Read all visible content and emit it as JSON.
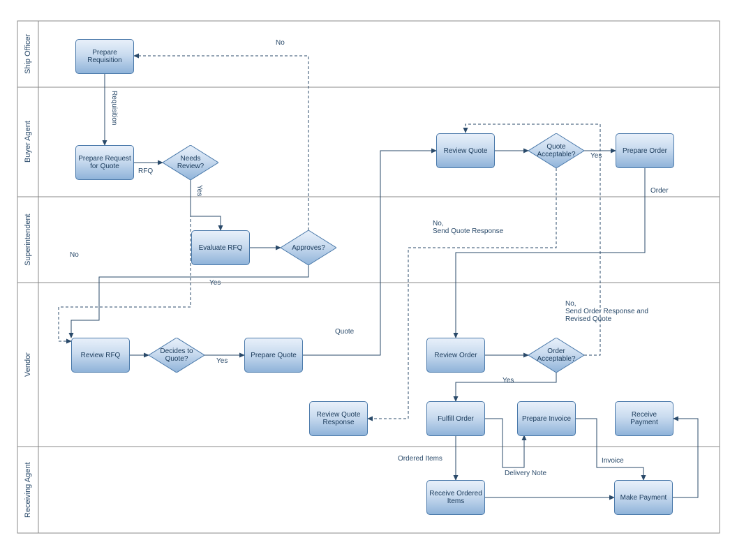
{
  "lanes": {
    "ship_officer": "Ship Officer",
    "buyer_agent": "Buyer Agent",
    "superintendent": "Superintendent",
    "vendor": "Vendor",
    "receiving_agent": "Receiving Agent"
  },
  "boxes": {
    "prepare_requisition": "Prepare\nRequisition",
    "prepare_rfq": "Prepare\nRequest for\nQuote",
    "evaluate_rfq": "Evaluate RFQ",
    "review_rfq": "Review RFQ",
    "prepare_quote": "Prepare\nQuote",
    "review_quote_response": "Review\nQuote\nResponse",
    "review_quote": "Review\nQuote",
    "prepare_order": "Prepare\nOrder",
    "review_order": "Review Order",
    "fulfill_order": "Fulfill Order",
    "prepare_invoice": "Prepare\nInvoice",
    "receive_payment": "Receive\nPayment",
    "receive_ordered_items": "Receive\nOrdered\nItems",
    "make_payment": "Make\nPayment"
  },
  "diamonds": {
    "needs_review": "Needs\nReview?",
    "approves": "Approves?",
    "decides_to_quote": "Decides\nto Quote?",
    "quote_acceptable": "Quote\nAcceptable?",
    "order_acceptable": "Order\nAcceptable?"
  },
  "labels": {
    "no1": "No",
    "requisition": "Requisition",
    "rfq": "RFQ",
    "yes1": "Yes",
    "no2": "No",
    "yes2": "Yes",
    "yes3": "Yes",
    "quote": "Quote",
    "yes4": "Yes",
    "order": "Order",
    "no_send_quote_response": "No,\nSend Quote Response",
    "no_send_order_response": "No,\nSend Order Response and\nRevised Quote",
    "yes5": "Yes",
    "ordered_items": "Ordered Items",
    "delivery_note": "Delivery Note",
    "invoice": "Invoice"
  }
}
